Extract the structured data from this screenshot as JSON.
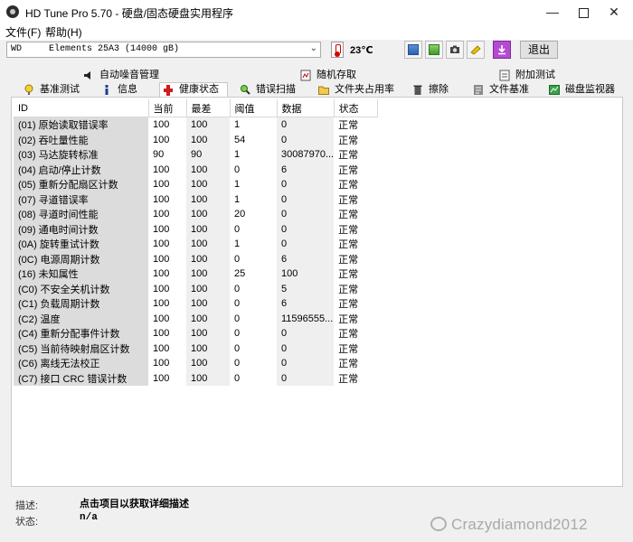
{
  "window": {
    "title": "HD Tune Pro 5.70 - 硬盘/固态硬盘实用程序",
    "minimize_glyph": "—",
    "close_glyph": "✕"
  },
  "menu": [
    "文件(F)",
    "帮助(H)"
  ],
  "toolbar": {
    "drive_selected": "WD     Elements 25A3 (14000 gB)",
    "temperature": "23℃",
    "exit_label": "退出",
    "buttons": [
      "copy-info-icon",
      "copy-text-icon",
      "screenshot-icon",
      "options-icon",
      "save-download-icon"
    ]
  },
  "tabs_top": [
    "自动噪音管理",
    "随机存取",
    "附加测试"
  ],
  "tabs_bottom": [
    "基准测试",
    "信息",
    "健康状态",
    "错误扫描",
    "文件夹占用率",
    "擦除",
    "文件基准",
    "磁盘监视器"
  ],
  "active_tab": "健康状态",
  "table": {
    "headers": [
      "ID",
      "当前",
      "最差",
      "阈值",
      "数据",
      "状态"
    ],
    "rows": [
      [
        "(01) 原始读取错误率",
        "100",
        "100",
        "1",
        "0",
        "正常"
      ],
      [
        "(02) 吞吐量性能",
        "100",
        "100",
        "54",
        "0",
        "正常"
      ],
      [
        "(03) 马达旋转标准",
        "90",
        "90",
        "1",
        "30087970...",
        "正常"
      ],
      [
        "(04) 启动/停止计数",
        "100",
        "100",
        "0",
        "6",
        "正常"
      ],
      [
        "(05) 重新分配扇区计数",
        "100",
        "100",
        "1",
        "0",
        "正常"
      ],
      [
        "(07) 寻道错误率",
        "100",
        "100",
        "1",
        "0",
        "正常"
      ],
      [
        "(08) 寻道时间性能",
        "100",
        "100",
        "20",
        "0",
        "正常"
      ],
      [
        "(09) 通电时间计数",
        "100",
        "100",
        "0",
        "0",
        "正常"
      ],
      [
        "(0A) 旋转重试计数",
        "100",
        "100",
        "1",
        "0",
        "正常"
      ],
      [
        "(0C) 电源周期计数",
        "100",
        "100",
        "0",
        "6",
        "正常"
      ],
      [
        "(16) 未知属性",
        "100",
        "100",
        "25",
        "100",
        "正常"
      ],
      [
        "(C0) 不安全关机计数",
        "100",
        "100",
        "0",
        "5",
        "正常"
      ],
      [
        "(C1) 负载周期计数",
        "100",
        "100",
        "0",
        "6",
        "正常"
      ],
      [
        "(C2) 温度",
        "100",
        "100",
        "0",
        "11596555...",
        "正常"
      ],
      [
        "(C4) 重新分配事件计数",
        "100",
        "100",
        "0",
        "0",
        "正常"
      ],
      [
        "(C5) 当前待映射扇区计数",
        "100",
        "100",
        "0",
        "0",
        "正常"
      ],
      [
        "(C6) 离线无法校正",
        "100",
        "100",
        "0",
        "0",
        "正常"
      ],
      [
        "(C7) 接口 CRC 错误计数",
        "100",
        "100",
        "0",
        "0",
        "正常"
      ]
    ]
  },
  "footer": {
    "desc_label": "描述:",
    "desc_value": "点击项目以获取详细描述",
    "status_label": "状态:",
    "status_value": "n/a"
  },
  "watermark": "Crazydiamond2012"
}
